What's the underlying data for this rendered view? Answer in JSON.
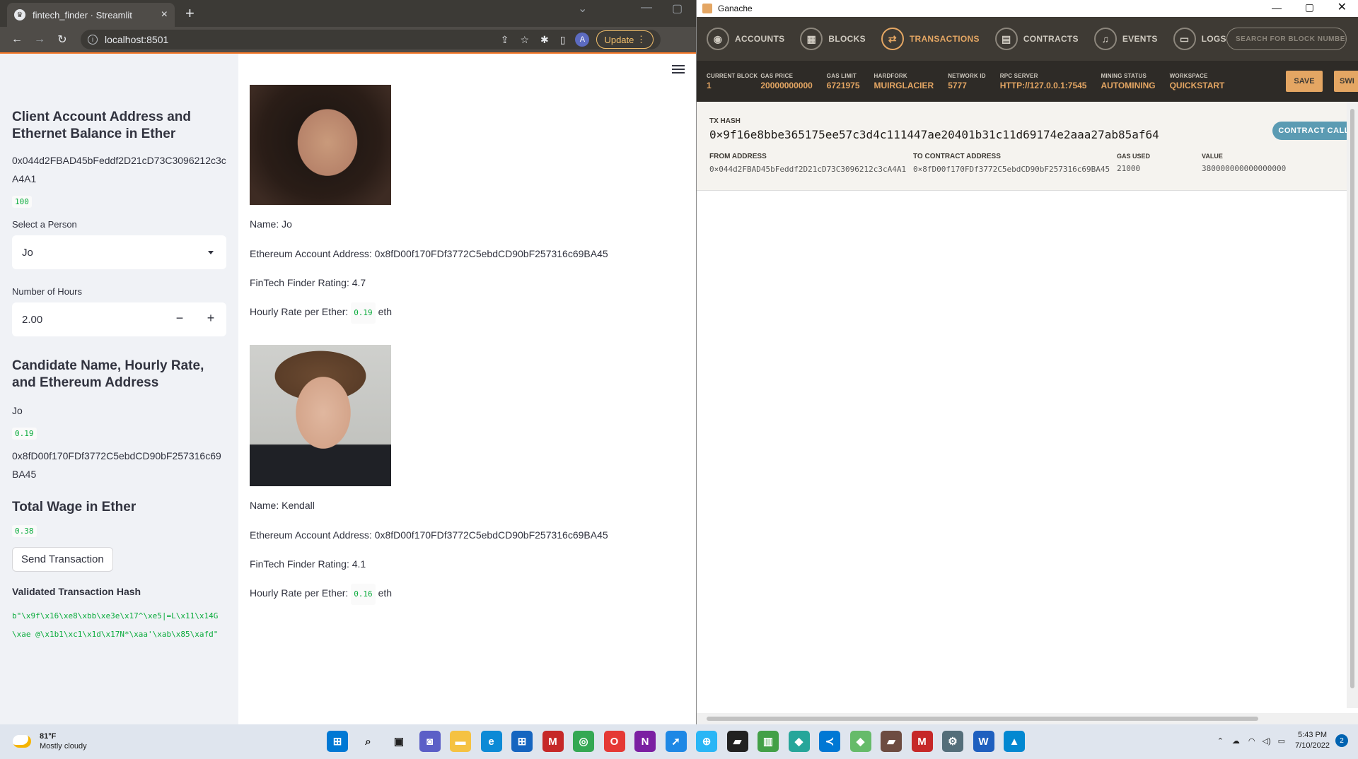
{
  "browser": {
    "tab_title": "fintech_finder · Streamlit",
    "url": "localhost:8501",
    "update_label": "Update",
    "profile_initial": "A"
  },
  "sidebar": {
    "client_header": "Client Account Address and Ethernet Balance in Ether",
    "client_address": "0x044d2FBAD45bFeddf2D21cD73C3096212c3cA4A1",
    "client_balance": "100",
    "select_label": "Select a Person",
    "select_value": "Jo",
    "hours_label": "Number of Hours",
    "hours_value": "2.00",
    "candidate_header": "Candidate Name, Hourly Rate, and Ethereum Address",
    "candidate_name": "Jo",
    "candidate_rate": "0.19",
    "candidate_address": "0x8fD00f170FDf3772C5ebdCD90bF257316c69BA45",
    "total_wage_header": "Total Wage in Ether",
    "total_wage": "0.38",
    "send_button": "Send Transaction",
    "validated_header": "Validated Transaction Hash",
    "tx_hash_bytes": "b\"\\x9f\\x16\\xe8\\xbb\\xe3e\\x17^\\xe5|=L\\x11\\x14G\\xae @\\x1b1\\xc1\\x1d\\x17N*\\xaa'\\xab\\x85\\xafd\""
  },
  "candidates": [
    {
      "name_line": "Name: Jo",
      "address_line": "Ethereum Account Address: 0x8fD00f170FDf3772C5ebdCD90bF257316c69BA45",
      "rating_line": "FinTech Finder Rating: 4.7",
      "rate_label": "Hourly Rate per Ether:",
      "rate_value": "0.19",
      "rate_unit": "eth"
    },
    {
      "name_line": "Name: Kendall",
      "address_line": "Ethereum Account Address: 0x8fD00f170FDf3772C5ebdCD90bF257316c69BA45",
      "rating_line": "FinTech Finder Rating: 4.1",
      "rate_label": "Hourly Rate per Ether:",
      "rate_value": "0.16",
      "rate_unit": "eth"
    }
  ],
  "ganache": {
    "title": "Ganache",
    "nav": [
      "ACCOUNTS",
      "BLOCKS",
      "TRANSACTIONS",
      "CONTRACTS",
      "EVENTS",
      "LOGS"
    ],
    "search_placeholder": "SEARCH FOR BLOCK NUMBERS OR TX HASHES",
    "stats": [
      {
        "k": "CURRENT BLOCK",
        "v": "1"
      },
      {
        "k": "GAS PRICE",
        "v": "20000000000"
      },
      {
        "k": "GAS LIMIT",
        "v": "6721975"
      },
      {
        "k": "HARDFORK",
        "v": "MUIRGLACIER"
      },
      {
        "k": "NETWORK ID",
        "v": "5777"
      },
      {
        "k": "RPC SERVER",
        "v": "HTTP://127.0.0.1:7545"
      },
      {
        "k": "MINING STATUS",
        "v": "AUTOMINING"
      },
      {
        "k": "WORKSPACE",
        "v": "QUICKSTART"
      }
    ],
    "save_label": "SAVE",
    "switch_label": "SWI",
    "tx": {
      "hash_label": "TX HASH",
      "hash": "0×9f16e8bbe365175ee57c3d4c111447ae20401b31c11d69174e2aaa27ab85af64",
      "contract_call": "CONTRACT CALL",
      "from_label": "FROM ADDRESS",
      "from": "0×044d2FBAD45bFeddf2D21cD73C3096212c3cA4A1",
      "to_label": "TO CONTRACT ADDRESS",
      "to": "0×8fD00f170FDf3772C5ebdCD90bF257316c69BA45",
      "gas_label": "GAS USED",
      "gas": "21000",
      "value_label": "VALUE",
      "value": "380000000000000000"
    }
  },
  "taskbar": {
    "temp": "81°F",
    "weather": "Mostly cloudy",
    "time": "5:43 PM",
    "date": "7/10/2022",
    "notif_count": "2"
  }
}
